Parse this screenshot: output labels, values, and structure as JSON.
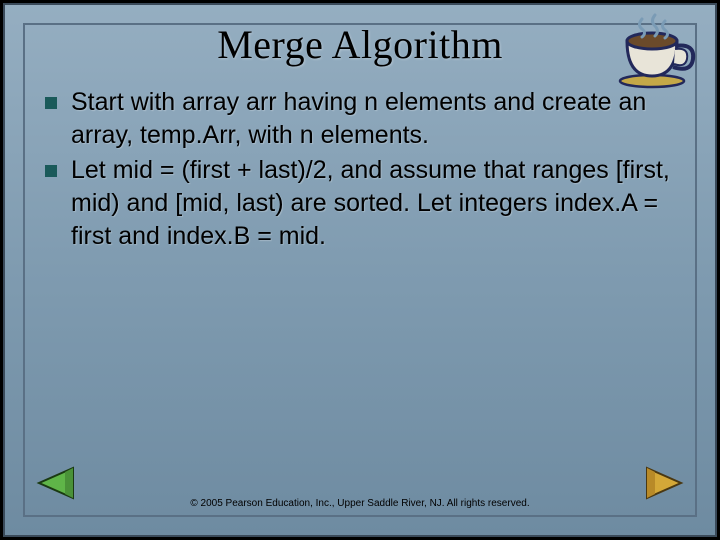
{
  "title": "Merge Algorithm",
  "bullets": [
    "Start with array arr having n elements and create an array, temp.Arr, with n elements.",
    "Let mid = (first + last)/2, and assume that ranges [first, mid) and [mid, last) are sorted. Let integers index.A = first and index.B = mid."
  ],
  "footer": "© 2005 Pearson Education, Inc., Upper Saddle River, NJ. All rights reserved.",
  "icons": {
    "coffee": "coffee-cup",
    "back": "arrow-left",
    "forward": "arrow-right"
  }
}
